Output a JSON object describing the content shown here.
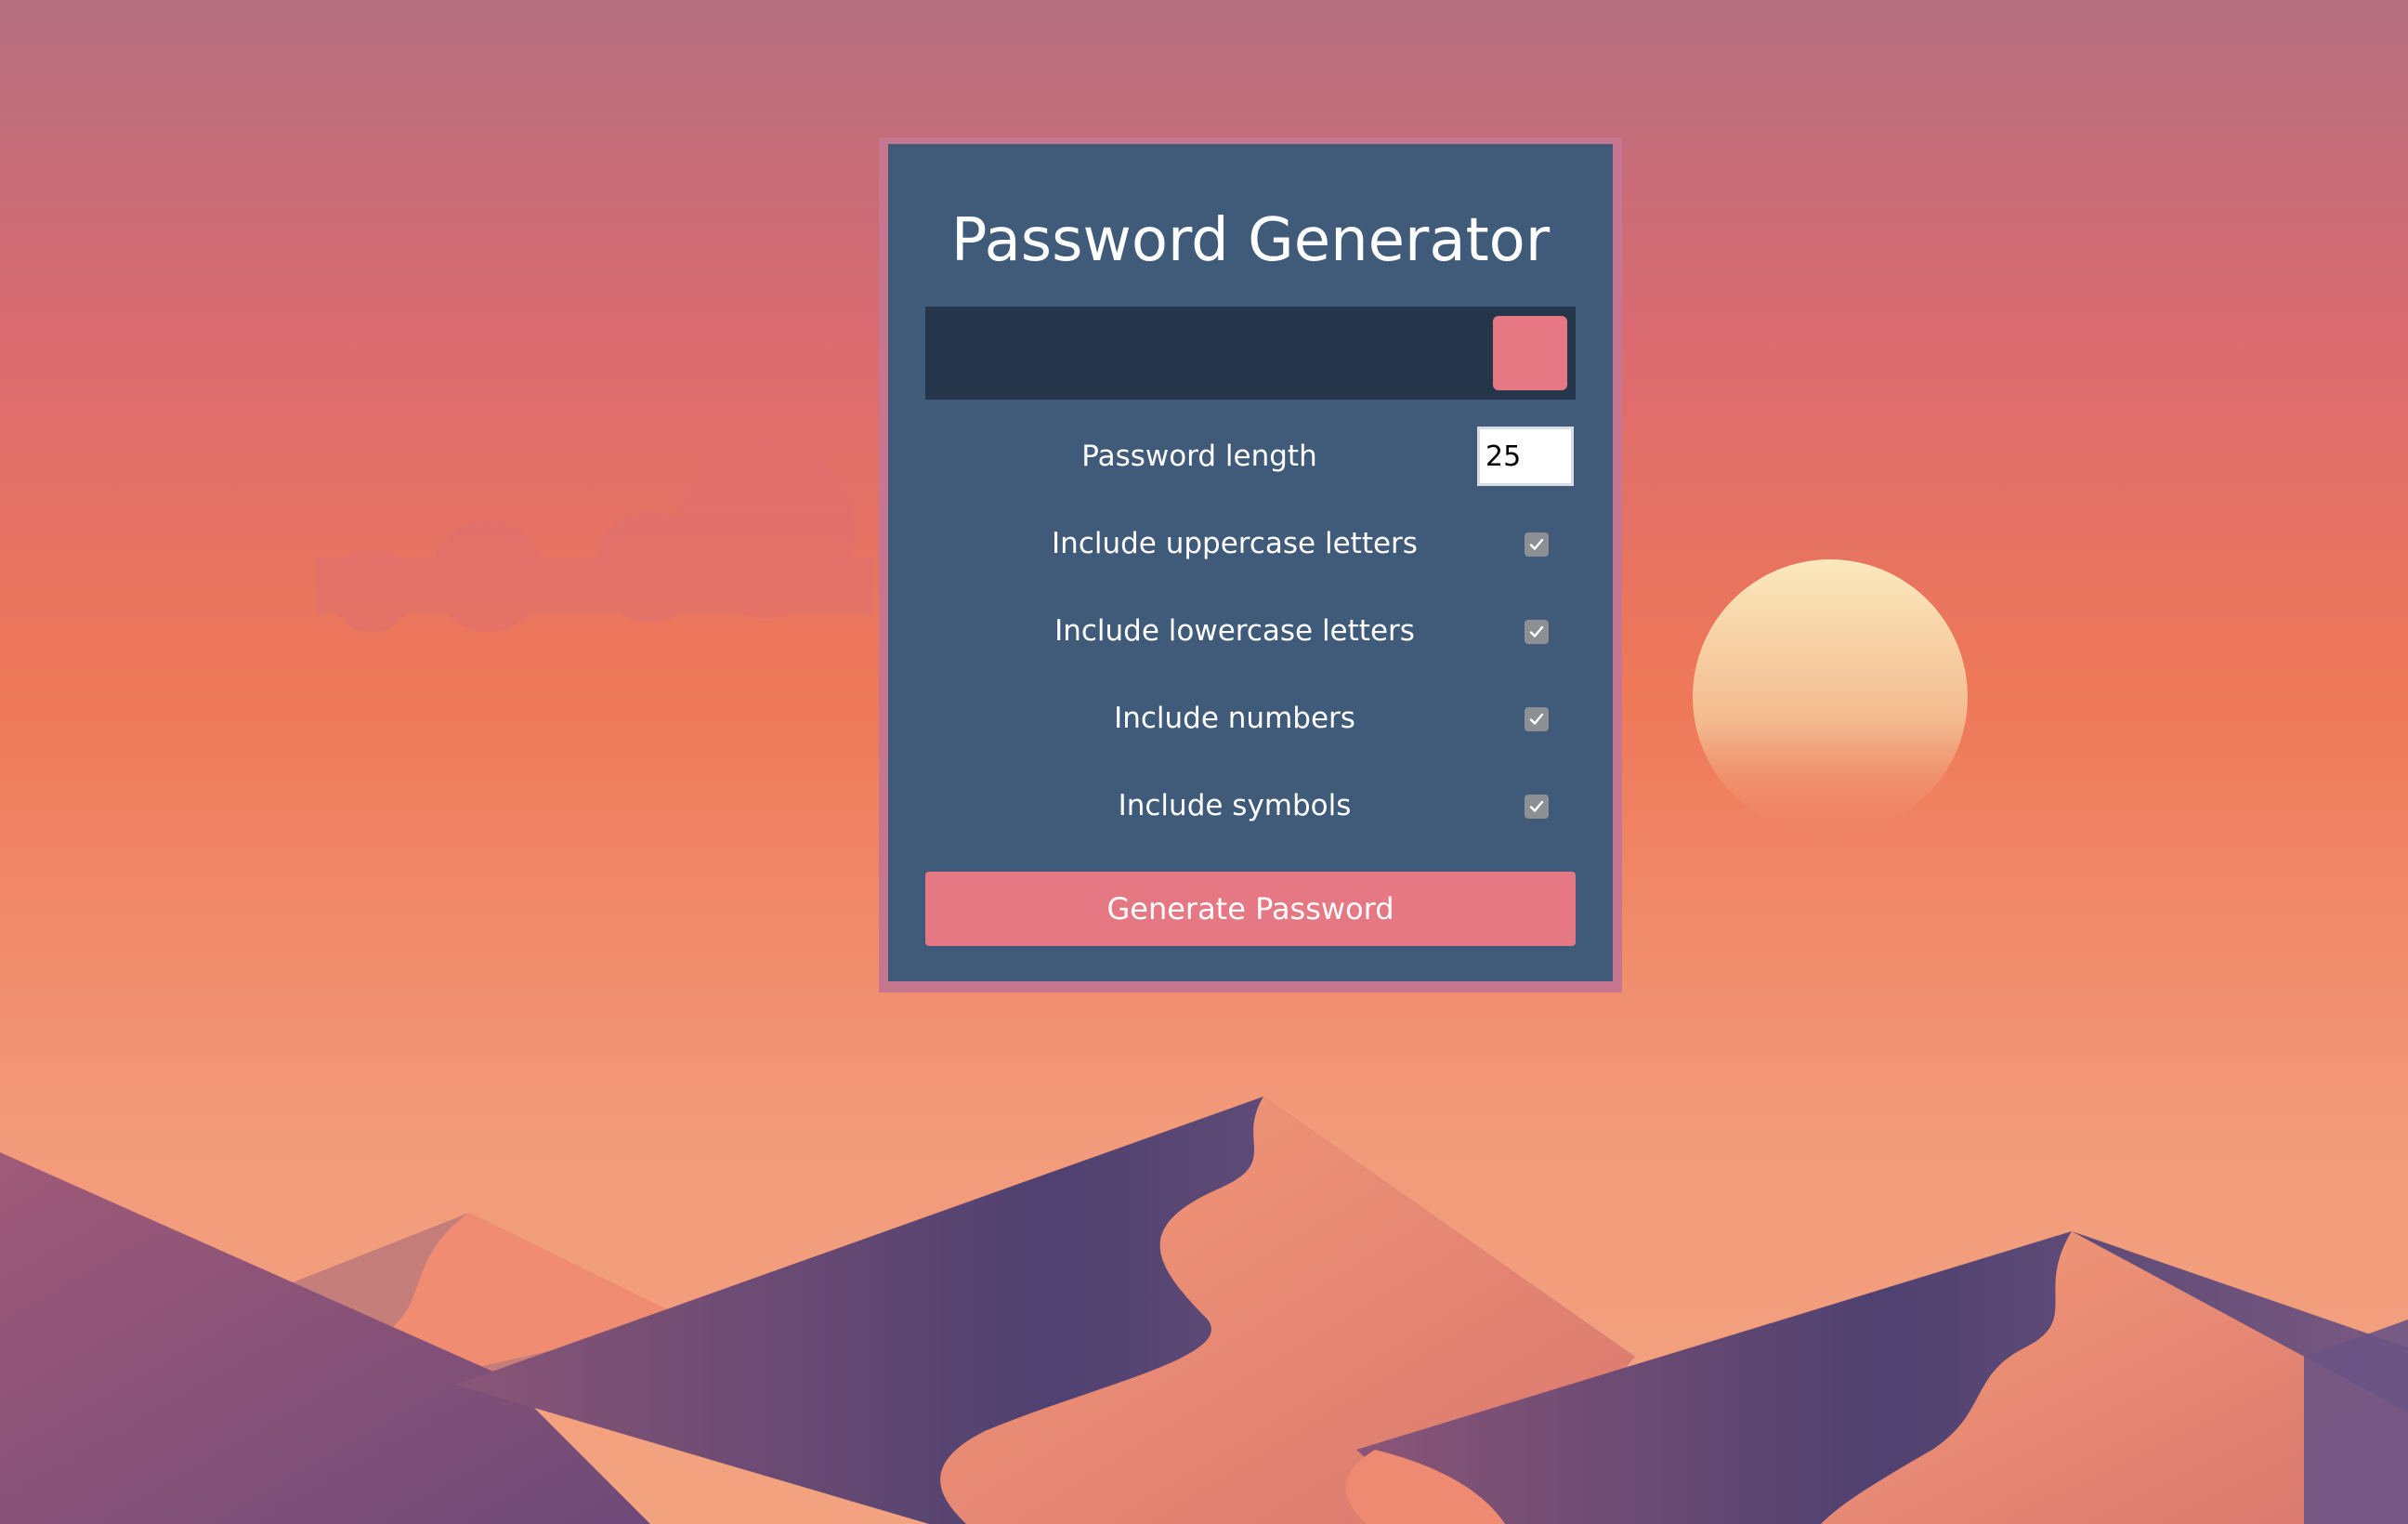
{
  "app": {
    "title": "Password Generator",
    "generated_password": ""
  },
  "copy_button": {
    "icon": "clipboard-icon"
  },
  "length_option": {
    "label": "Password length",
    "value": "25"
  },
  "options": [
    {
      "label": "Include uppercase letters",
      "checked": true
    },
    {
      "label": "Include lowercase letters",
      "checked": true
    },
    {
      "label": "Include numbers",
      "checked": true
    },
    {
      "label": "Include symbols",
      "checked": true
    }
  ],
  "generate_button": {
    "label": "Generate Password"
  },
  "colors": {
    "panel": "#3f5b79",
    "panel_border": "#c7768f",
    "result_box": "#25354a",
    "accent": "#e57882"
  }
}
